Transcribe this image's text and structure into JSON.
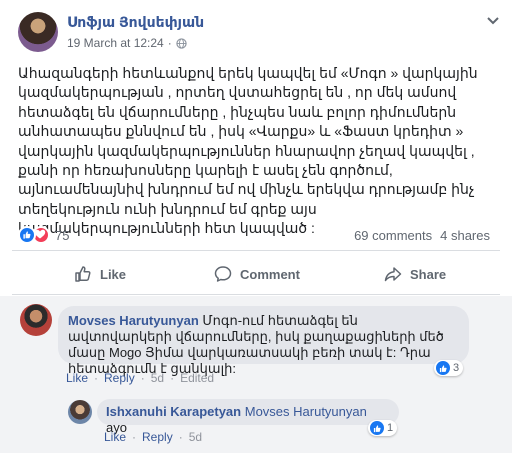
{
  "post": {
    "author": "Սոֆյա Յովսեփյան",
    "timestamp": "19 March at 12:24",
    "separator": "·",
    "privacy_icon": "globe-icon",
    "menu_icon": "chevron-down-icon",
    "text": "Ահազանգերի հետևանքով երեկ կապվել եմ «Մոգո » վարկային կազմակերպության , որտեղ վստահեցրել են , որ մեկ ամսով հետաձգել են վճարումները , ինչպես նաև բոլոր դիմումներն անհատապես քննվում են , իսկ «Վարքս» և «Ֆաստ կրեդիտ » վարկային կազմակերպություններ հնարավոր չեղավ կապվել , քանի որ հեռախոսները կարելի է ասել չեն գործում, այնուամենայնիվ խնդրում եմ ով մինչև երեկվա դրությամբ ինչ տեղեկություն ունի խնդրում եմ գրեք այս կազմակերպությունների հետ կապված :",
    "reaction_count": "75",
    "comments_count": "69 comments",
    "shares_count": "4 shares"
  },
  "actions": {
    "like": "Like",
    "comment": "Comment",
    "share": "Share"
  },
  "comments": [
    {
      "author": "Movses Harutyunyan",
      "text": "Մոգո-ում հետաձգել են ավտովարկերի վճարումները, իսկ քաղաքացիների մեծ մասը Mogo Յիմա վարկառատսակի բեռի տակ է: Դրա հետաձգումն է ցանկալի:",
      "like_label": "Like",
      "reply_label": "Reply",
      "sep": "·",
      "age": "5d",
      "edited": "Edited",
      "reaction_count": "3"
    },
    {
      "author": "Ishxanuhi Karapetyan",
      "mention": "Movses Harutyunyan",
      "text": "ayo",
      "like_label": "Like",
      "reply_label": "Reply",
      "sep": "·",
      "age": "5d",
      "reaction_count": "1"
    }
  ],
  "colors": {
    "link": "#385898",
    "like_blue": "#1877f2",
    "love_red": "#f33e58",
    "muted": "#606770",
    "comment_bg": "#f2f3f5",
    "bubble_bg": "#e4e6eb"
  }
}
